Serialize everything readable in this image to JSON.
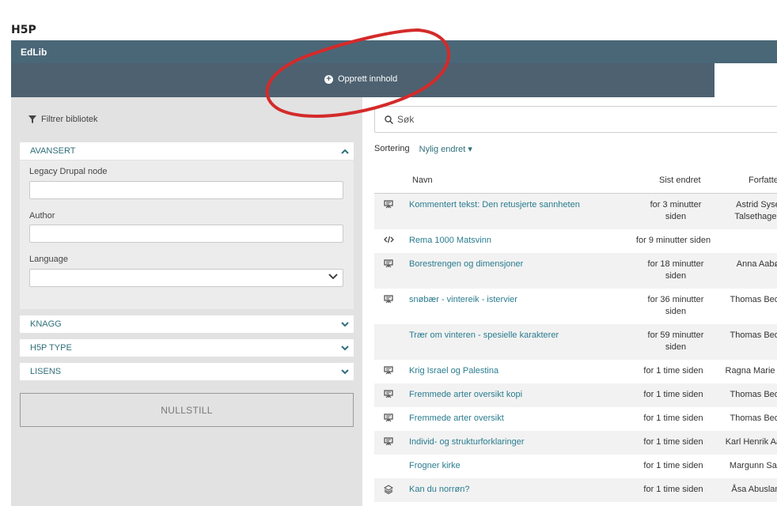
{
  "page_heading": "H5P",
  "topbar": {
    "brand": "EdLib"
  },
  "create": {
    "label": "Opprett innhold"
  },
  "sidebar": {
    "filter_title": "Filtrer bibliotek",
    "advanced": {
      "title": "AVANSERT",
      "fields": [
        {
          "label": "Legacy Drupal node",
          "value": ""
        },
        {
          "label": "Author",
          "value": ""
        },
        {
          "label": "Language",
          "value": ""
        }
      ]
    },
    "panels": [
      "KNAGG",
      "H5P TYPE",
      "LISENS"
    ],
    "reset_label": "NULLSTILL"
  },
  "search": {
    "placeholder": "Søk"
  },
  "sort": {
    "label": "Sortering",
    "value": "Nylig endret"
  },
  "table": {
    "headers": {
      "name": "Navn",
      "date": "Sist endret",
      "author": "Forfatter"
    },
    "rows": [
      {
        "icon": "presentation-icon",
        "name": "Kommentert tekst: Den retusjerte sannheten",
        "date": "for 3 minutter siden",
        "author": "Astrid Syse Talsethagen"
      },
      {
        "icon": "code-icon",
        "name": "Rema 1000 Matsvinn",
        "date": "for 9 minutter siden",
        "author": ""
      },
      {
        "icon": "presentation-icon",
        "name": "Borestrengen og dimensjoner",
        "date": "for 18 minutter siden",
        "author": "Anna Aabø"
      },
      {
        "icon": "presentation-icon",
        "name": "snøbær - vintereik - istervier",
        "date": "for 36 minutter siden",
        "author": "Thomas Bedin"
      },
      {
        "icon": "",
        "name": "Trær om vinteren - spesielle karakterer",
        "date": "for 59 minutter siden",
        "author": "Thomas Bedin"
      },
      {
        "icon": "presentation-icon",
        "name": "Krig Israel og Palestina",
        "date": "for 1 time siden",
        "author": "Ragna Marie Tør"
      },
      {
        "icon": "presentation-icon",
        "name": "Fremmede arter oversikt kopi",
        "date": "for 1 time siden",
        "author": "Thomas Bedin"
      },
      {
        "icon": "presentation-icon",
        "name": "Fremmede arter oversikt",
        "date": "for 1 time siden",
        "author": "Thomas Bedin"
      },
      {
        "icon": "presentation-icon",
        "name": "Individ- og strukturforklaringer",
        "date": "for 1 time siden",
        "author": "Karl Henrik Aane"
      },
      {
        "icon": "",
        "name": "Frogner kirke",
        "date": "for 1 time siden",
        "author": "Margunn Sand"
      },
      {
        "icon": "layers-icon",
        "name": "Kan du norrøn?",
        "date": "for 1 time siden",
        "author": "Åsa Abusland"
      }
    ]
  },
  "colors": {
    "topbar": "#4a6778",
    "createbar": "#4d6170",
    "link": "#2a7c8f",
    "annotation": "#d42a2a"
  }
}
